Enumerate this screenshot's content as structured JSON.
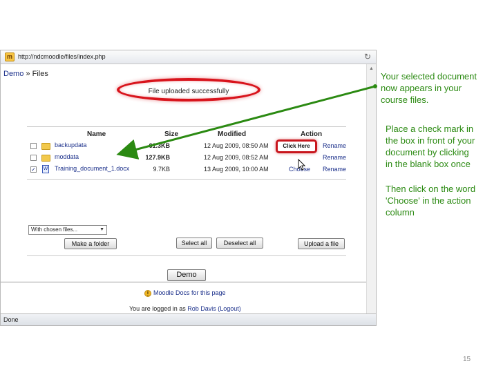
{
  "browser": {
    "url": "http://ndcmoodle/files/index.php",
    "status": "Done"
  },
  "page": {
    "breadcrumb": {
      "course": "Demo",
      "separator": "»",
      "current": "Files"
    },
    "notification": "File uploaded successfully",
    "table": {
      "headers": {
        "name": "Name",
        "size": "Size",
        "modified": "Modified",
        "action": "Action"
      },
      "rows": [
        {
          "name": "backupdata",
          "size": "61.3KB",
          "modified": "12 Aug 2009, 08:50 AM",
          "choose": "",
          "rename": "Rename",
          "checked": false,
          "type": "folder"
        },
        {
          "name": "moddata",
          "size": "127.9KB",
          "modified": "12 Aug 2009, 08:52 AM",
          "choose": "",
          "rename": "Rename",
          "checked": false,
          "type": "folder"
        },
        {
          "name": "Training_document_1.docx",
          "size": "9.7KB",
          "modified": "13 Aug 2009, 10:00 AM",
          "choose": "Choose",
          "rename": "Rename",
          "checked": true,
          "type": "document"
        }
      ]
    },
    "with_chosen_select": "With chosen files...",
    "buttons": {
      "make_folder": "Make a folder",
      "select_all": "Select all",
      "deselect_all": "Deselect all",
      "upload_file": "Upload a file",
      "demo": "Demo"
    },
    "docs_link": "Moodle Docs for this page",
    "login": {
      "prefix": "You are logged in as",
      "user": "Rob Davis",
      "logout": "(Logout)"
    }
  },
  "callout": {
    "label": "Click Here"
  },
  "annotations": {
    "top": [
      "Your selected document",
      "now appears in your",
      "course files."
    ],
    "middle": [
      "Place a check mark in",
      "the box in front of your",
      "document by clicking",
      "in the blank box once"
    ],
    "bottom": [
      "Then click on the word",
      "'Choose' in the action",
      "column"
    ]
  },
  "slide_number": "15",
  "colors": {
    "annotation_green": "#2b8a12",
    "highlight_red": "#d8141c",
    "link_blue": "#1a2f8a"
  }
}
